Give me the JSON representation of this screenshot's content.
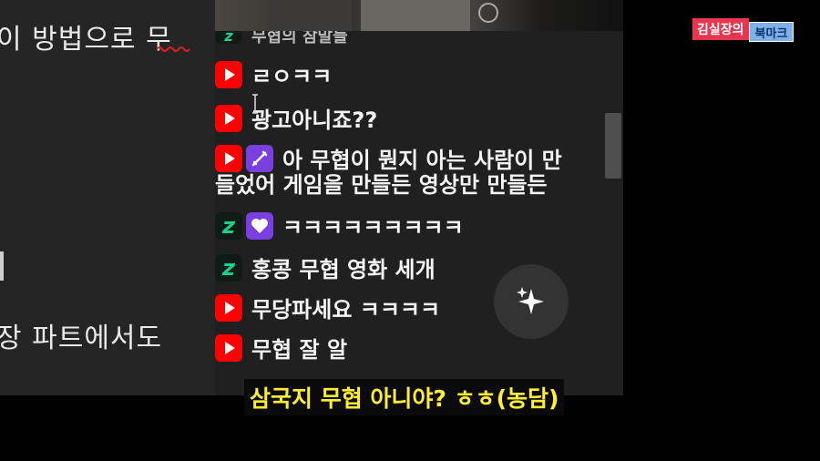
{
  "left_pane": {
    "lines": [
      "이 방법으로 무",
      "장 파트에서도"
    ]
  },
  "logo": {
    "part1": "김실장의",
    "part2": "북마크"
  },
  "chat": {
    "partial_top": "무협의 참말들",
    "messages": [
      {
        "badge": "youtube-icon",
        "text": "ㄹㅇㅋㅋ"
      },
      {
        "badge": "youtube-icon",
        "text": "광고아니죠??"
      },
      {
        "badge": "youtube-icon",
        "extra_badge": "sword-icon",
        "line1": "아 무협이 뭔지 아는 사람이 만",
        "line2": "들었어 게임을 만들든 영상만 만들든"
      },
      {
        "badge": "z-icon",
        "extra_badge": "heart-icon",
        "text": "ㅋㅋㅋㅋㅋㅋㅋㅋㅋ"
      },
      {
        "badge": "z-icon",
        "text": "홍콩 무협 영화 세개"
      },
      {
        "badge": "youtube-icon",
        "text": "무당파세요 ㅋㅋㅋㅋ"
      },
      {
        "badge": "youtube-icon",
        "text": "무협 잘 알"
      }
    ]
  },
  "subtitle": "삼국지 무협 아니야? ㅎㅎ(농담)",
  "colors": {
    "youtube_red": "#ff0000",
    "subtitle_yellow": "#ffee33",
    "purple_badge": "#7b3fe0",
    "z_green": "#19d18d"
  }
}
